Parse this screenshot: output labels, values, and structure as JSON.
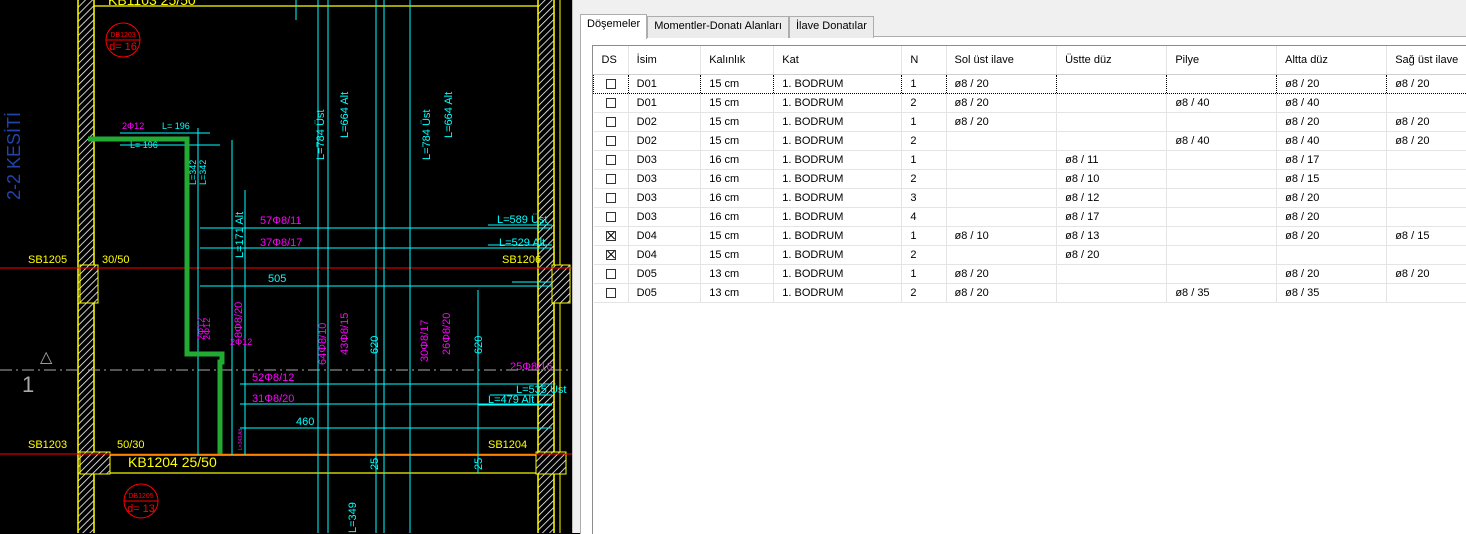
{
  "cad": {
    "section_label": "2-2 KESİTİ",
    "beam_top": "KB1103 25/50",
    "beam_bottom": "KB1204 25/50",
    "slab_tag_top": {
      "code": "DB1203",
      "thickness": "d= 16"
    },
    "slab_tag_bottom": {
      "code": "DB1205",
      "thickness": "d= 13"
    },
    "sb1205": "SB1205",
    "sb1205_size": "30/50",
    "sb1206": "SB1206",
    "sb1203": "SB1203",
    "sb1203_size": "50/30",
    "sb1204": "SB1204",
    "rebar_labels": [
      "2Φ12",
      "L= 196",
      "L= 196",
      "L=342",
      "L=342",
      "L=171 Alt",
      "L=784 Üst",
      "L=664 Alt",
      "L=784 Üst",
      "L=664 Alt",
      "57Φ8/11",
      "37Φ8/17",
      "L=589 Üst",
      "L=529 Alt",
      "505",
      "8Φ8/20",
      "2Φ12",
      "2Φ12",
      "2Φ12",
      "64Φ8/10",
      "43Φ8/15",
      "620",
      "30Φ8/17",
      "26Φ8/20",
      "620",
      "52Φ8/12",
      "31Φ8/20",
      "25Φ8/16",
      "L=535 Üst",
      "L=479 Alt",
      "460",
      "25",
      "25",
      "L=349",
      "L=343 Alt"
    ],
    "axis_number": "1",
    "colors": {
      "beam": "#ffff00",
      "rebar_line": "#00ffff",
      "rebar_text": "#ff00ff",
      "selection": "#22aa33",
      "section": "#2222aa",
      "tag": "#ff0000"
    }
  },
  "tabs": [
    "Döşemeler",
    "Momentler-Donatı Alanları",
    "İlave Donatılar"
  ],
  "active_tab": "Döşemeler",
  "table": {
    "columns": [
      "DS",
      "İsim",
      "Kalınlık",
      "Kat",
      "N",
      "Sol üst ilave",
      "Üstte düz",
      "Pilye",
      "Altta düz",
      "Sağ üst ilave"
    ],
    "rows": [
      {
        "checked": false,
        "cells": [
          "D01",
          "15 cm",
          "1. BODRUM",
          "1",
          "ø8 / 20",
          "",
          "",
          "ø8 / 20",
          "ø8 / 20"
        ]
      },
      {
        "checked": false,
        "cells": [
          "D01",
          "15 cm",
          "1. BODRUM",
          "2",
          "ø8 / 20",
          "",
          "ø8 / 40",
          "ø8 / 40",
          ""
        ]
      },
      {
        "checked": false,
        "cells": [
          "D02",
          "15 cm",
          "1. BODRUM",
          "1",
          "ø8 / 20",
          "",
          "",
          "ø8 / 20",
          "ø8 / 20"
        ]
      },
      {
        "checked": false,
        "cells": [
          "D02",
          "15 cm",
          "1. BODRUM",
          "2",
          "",
          "",
          "ø8 / 40",
          "ø8 / 40",
          "ø8 / 20"
        ]
      },
      {
        "checked": false,
        "cells": [
          "D03",
          "16 cm",
          "1. BODRUM",
          "1",
          "",
          "ø8 / 11",
          "",
          "ø8 / 17",
          ""
        ]
      },
      {
        "checked": false,
        "cells": [
          "D03",
          "16 cm",
          "1. BODRUM",
          "2",
          "",
          "ø8 / 10",
          "",
          "ø8 / 15",
          ""
        ]
      },
      {
        "checked": false,
        "cells": [
          "D03",
          "16 cm",
          "1. BODRUM",
          "3",
          "",
          "ø8 / 12",
          "",
          "ø8 / 20",
          ""
        ]
      },
      {
        "checked": false,
        "cells": [
          "D03",
          "16 cm",
          "1. BODRUM",
          "4",
          "",
          "ø8 / 17",
          "",
          "ø8 / 20",
          ""
        ]
      },
      {
        "checked": true,
        "cells": [
          "D04",
          "15 cm",
          "1. BODRUM",
          "1",
          "ø8 / 10",
          "ø8 / 13",
          "",
          "ø8 / 20",
          "ø8 / 15"
        ]
      },
      {
        "checked": true,
        "cells": [
          "D04",
          "15 cm",
          "1. BODRUM",
          "2",
          "",
          "ø8 / 20",
          "",
          "",
          ""
        ]
      },
      {
        "checked": false,
        "cells": [
          "D05",
          "13 cm",
          "1. BODRUM",
          "1",
          "ø8 / 20",
          "",
          "",
          "ø8 / 20",
          "ø8 / 20"
        ]
      },
      {
        "checked": false,
        "cells": [
          "D05",
          "13 cm",
          "1. BODRUM",
          "2",
          "ø8 / 20",
          "",
          "ø8 / 35",
          "ø8 / 35",
          ""
        ]
      }
    ]
  }
}
